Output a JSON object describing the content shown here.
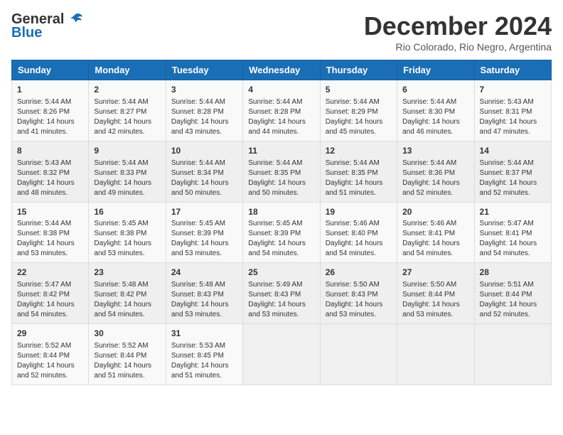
{
  "header": {
    "logo": {
      "general": "General",
      "blue": "Blue"
    },
    "title": "December 2024",
    "subtitle": "Rio Colorado, Rio Negro, Argentina"
  },
  "calendar": {
    "days_of_week": [
      "Sunday",
      "Monday",
      "Tuesday",
      "Wednesday",
      "Thursday",
      "Friday",
      "Saturday"
    ],
    "weeks": [
      [
        {
          "day": "1",
          "sunrise": "Sunrise: 5:44 AM",
          "sunset": "Sunset: 8:26 PM",
          "daylight": "Daylight: 14 hours and 41 minutes."
        },
        {
          "day": "2",
          "sunrise": "Sunrise: 5:44 AM",
          "sunset": "Sunset: 8:27 PM",
          "daylight": "Daylight: 14 hours and 42 minutes."
        },
        {
          "day": "3",
          "sunrise": "Sunrise: 5:44 AM",
          "sunset": "Sunset: 8:28 PM",
          "daylight": "Daylight: 14 hours and 43 minutes."
        },
        {
          "day": "4",
          "sunrise": "Sunrise: 5:44 AM",
          "sunset": "Sunset: 8:28 PM",
          "daylight": "Daylight: 14 hours and 44 minutes."
        },
        {
          "day": "5",
          "sunrise": "Sunrise: 5:44 AM",
          "sunset": "Sunset: 8:29 PM",
          "daylight": "Daylight: 14 hours and 45 minutes."
        },
        {
          "day": "6",
          "sunrise": "Sunrise: 5:44 AM",
          "sunset": "Sunset: 8:30 PM",
          "daylight": "Daylight: 14 hours and 46 minutes."
        },
        {
          "day": "7",
          "sunrise": "Sunrise: 5:43 AM",
          "sunset": "Sunset: 8:31 PM",
          "daylight": "Daylight: 14 hours and 47 minutes."
        }
      ],
      [
        {
          "day": "8",
          "sunrise": "Sunrise: 5:43 AM",
          "sunset": "Sunset: 8:32 PM",
          "daylight": "Daylight: 14 hours and 48 minutes."
        },
        {
          "day": "9",
          "sunrise": "Sunrise: 5:44 AM",
          "sunset": "Sunset: 8:33 PM",
          "daylight": "Daylight: 14 hours and 49 minutes."
        },
        {
          "day": "10",
          "sunrise": "Sunrise: 5:44 AM",
          "sunset": "Sunset: 8:34 PM",
          "daylight": "Daylight: 14 hours and 50 minutes."
        },
        {
          "day": "11",
          "sunrise": "Sunrise: 5:44 AM",
          "sunset": "Sunset: 8:35 PM",
          "daylight": "Daylight: 14 hours and 50 minutes."
        },
        {
          "day": "12",
          "sunrise": "Sunrise: 5:44 AM",
          "sunset": "Sunset: 8:35 PM",
          "daylight": "Daylight: 14 hours and 51 minutes."
        },
        {
          "day": "13",
          "sunrise": "Sunrise: 5:44 AM",
          "sunset": "Sunset: 8:36 PM",
          "daylight": "Daylight: 14 hours and 52 minutes."
        },
        {
          "day": "14",
          "sunrise": "Sunrise: 5:44 AM",
          "sunset": "Sunset: 8:37 PM",
          "daylight": "Daylight: 14 hours and 52 minutes."
        }
      ],
      [
        {
          "day": "15",
          "sunrise": "Sunrise: 5:44 AM",
          "sunset": "Sunset: 8:38 PM",
          "daylight": "Daylight: 14 hours and 53 minutes."
        },
        {
          "day": "16",
          "sunrise": "Sunrise: 5:45 AM",
          "sunset": "Sunset: 8:38 PM",
          "daylight": "Daylight: 14 hours and 53 minutes."
        },
        {
          "day": "17",
          "sunrise": "Sunrise: 5:45 AM",
          "sunset": "Sunset: 8:39 PM",
          "daylight": "Daylight: 14 hours and 53 minutes."
        },
        {
          "day": "18",
          "sunrise": "Sunrise: 5:45 AM",
          "sunset": "Sunset: 8:39 PM",
          "daylight": "Daylight: 14 hours and 54 minutes."
        },
        {
          "day": "19",
          "sunrise": "Sunrise: 5:46 AM",
          "sunset": "Sunset: 8:40 PM",
          "daylight": "Daylight: 14 hours and 54 minutes."
        },
        {
          "day": "20",
          "sunrise": "Sunrise: 5:46 AM",
          "sunset": "Sunset: 8:41 PM",
          "daylight": "Daylight: 14 hours and 54 minutes."
        },
        {
          "day": "21",
          "sunrise": "Sunrise: 5:47 AM",
          "sunset": "Sunset: 8:41 PM",
          "daylight": "Daylight: 14 hours and 54 minutes."
        }
      ],
      [
        {
          "day": "22",
          "sunrise": "Sunrise: 5:47 AM",
          "sunset": "Sunset: 8:42 PM",
          "daylight": "Daylight: 14 hours and 54 minutes."
        },
        {
          "day": "23",
          "sunrise": "Sunrise: 5:48 AM",
          "sunset": "Sunset: 8:42 PM",
          "daylight": "Daylight: 14 hours and 54 minutes."
        },
        {
          "day": "24",
          "sunrise": "Sunrise: 5:48 AM",
          "sunset": "Sunset: 8:43 PM",
          "daylight": "Daylight: 14 hours and 53 minutes."
        },
        {
          "day": "25",
          "sunrise": "Sunrise: 5:49 AM",
          "sunset": "Sunset: 8:43 PM",
          "daylight": "Daylight: 14 hours and 53 minutes."
        },
        {
          "day": "26",
          "sunrise": "Sunrise: 5:50 AM",
          "sunset": "Sunset: 8:43 PM",
          "daylight": "Daylight: 14 hours and 53 minutes."
        },
        {
          "day": "27",
          "sunrise": "Sunrise: 5:50 AM",
          "sunset": "Sunset: 8:44 PM",
          "daylight": "Daylight: 14 hours and 53 minutes."
        },
        {
          "day": "28",
          "sunrise": "Sunrise: 5:51 AM",
          "sunset": "Sunset: 8:44 PM",
          "daylight": "Daylight: 14 hours and 52 minutes."
        }
      ],
      [
        {
          "day": "29",
          "sunrise": "Sunrise: 5:52 AM",
          "sunset": "Sunset: 8:44 PM",
          "daylight": "Daylight: 14 hours and 52 minutes."
        },
        {
          "day": "30",
          "sunrise": "Sunrise: 5:52 AM",
          "sunset": "Sunset: 8:44 PM",
          "daylight": "Daylight: 14 hours and 51 minutes."
        },
        {
          "day": "31",
          "sunrise": "Sunrise: 5:53 AM",
          "sunset": "Sunset: 8:45 PM",
          "daylight": "Daylight: 14 hours and 51 minutes."
        },
        null,
        null,
        null,
        null
      ]
    ]
  }
}
